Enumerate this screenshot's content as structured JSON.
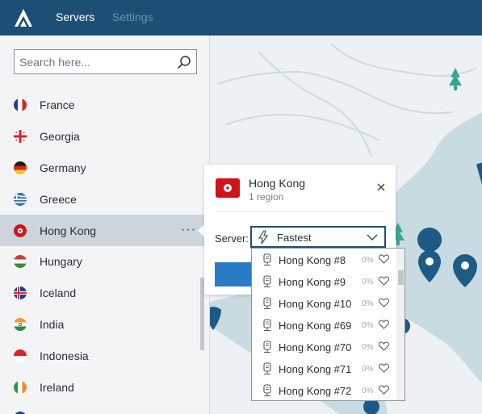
{
  "nav": {
    "tabs": [
      "Servers",
      "Settings"
    ]
  },
  "search": {
    "placeholder": "Search here..."
  },
  "countries": [
    "France",
    "Georgia",
    "Germany",
    "Greece",
    "Hong Kong",
    "Hungary",
    "Iceland",
    "India",
    "Indonesia",
    "Ireland"
  ],
  "selected_country": "Hong Kong",
  "popup": {
    "title": "Hong Kong",
    "subtitle": "1 region",
    "server_label": "Server:",
    "server_value": "Fastest"
  },
  "servers": [
    {
      "name": "Hong Kong #8",
      "load": "0%"
    },
    {
      "name": "Hong Kong #9",
      "load": "0%"
    },
    {
      "name": "Hong Kong #10",
      "load": "0%"
    },
    {
      "name": "Hong Kong #69",
      "load": "0%"
    },
    {
      "name": "Hong Kong #70",
      "load": "0%"
    },
    {
      "name": "Hong Kong #71",
      "load": "0%"
    },
    {
      "name": "Hong Kong #72",
      "load": "0%"
    }
  ],
  "colors": {
    "header": "#1d4f75",
    "map_water": "#c9dbe2",
    "map_land": "#eef1f3",
    "pin": "#1d5a86",
    "tree": "#3aa68f"
  }
}
